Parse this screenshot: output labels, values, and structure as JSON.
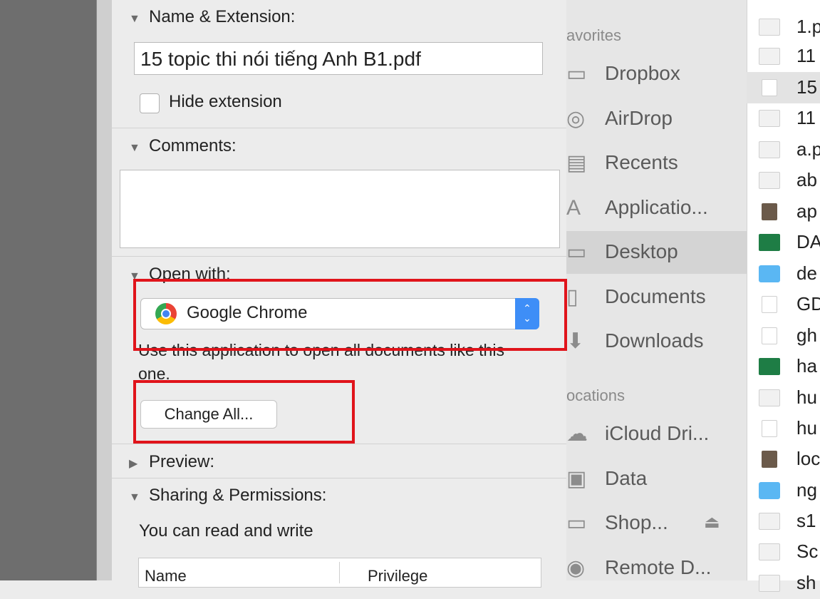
{
  "info_panel": {
    "name_ext_title": "Name & Extension:",
    "file_name": "15 topic thi nói tiếng Anh B1.pdf",
    "hide_extension_label": "Hide extension",
    "comments_title": "Comments:",
    "open_with_title": "Open with:",
    "app_name": "Google Chrome",
    "use_app_text": "Use this application to open all documents like this one.",
    "change_all_label": "Change All...",
    "preview_title": "Preview:",
    "sharing_title": "Sharing & Permissions:",
    "permission_text": "You can read and write",
    "table_headers": {
      "name": "Name",
      "privilege": "Privilege"
    }
  },
  "finder_sidebar": {
    "favorites_heading": "avorites",
    "locations_heading": "ocations",
    "favorites": [
      {
        "label": "Dropbox",
        "icon": "folder-icon"
      },
      {
        "label": "AirDrop",
        "icon": "airdrop-icon"
      },
      {
        "label": "Recents",
        "icon": "recents-icon"
      },
      {
        "label": "Applicatio...",
        "icon": "applications-icon"
      },
      {
        "label": "Desktop",
        "icon": "desktop-icon",
        "selected": true
      },
      {
        "label": "Documents",
        "icon": "documents-icon"
      },
      {
        "label": "Downloads",
        "icon": "downloads-icon"
      }
    ],
    "locations": [
      {
        "label": "iCloud Dri...",
        "icon": "cloud-icon"
      },
      {
        "label": "Data",
        "icon": "disk-icon"
      },
      {
        "label": "Shop...",
        "icon": "drive-icon",
        "eject": "⏏"
      },
      {
        "label": "Remote D...",
        "icon": "remote-disc-icon"
      }
    ]
  },
  "file_list": [
    {
      "name": "1.p",
      "kind": "blank"
    },
    {
      "name": "11",
      "kind": "blank"
    },
    {
      "name": "15",
      "kind": "doc",
      "selected": true
    },
    {
      "name": "11",
      "kind": "blank"
    },
    {
      "name": "a.p",
      "kind": "blank"
    },
    {
      "name": "ab",
      "kind": "blank"
    },
    {
      "name": "ap",
      "kind": "img"
    },
    {
      "name": "DA",
      "kind": "xl"
    },
    {
      "name": "de",
      "kind": "folder"
    },
    {
      "name": "GD",
      "kind": "doc"
    },
    {
      "name": "gh",
      "kind": "doc"
    },
    {
      "name": "ha",
      "kind": "xl"
    },
    {
      "name": "hu",
      "kind": "blank"
    },
    {
      "name": "hu",
      "kind": "doc"
    },
    {
      "name": "loc",
      "kind": "img"
    },
    {
      "name": "ng",
      "kind": "folder"
    },
    {
      "name": "s1",
      "kind": "blank"
    },
    {
      "name": "Sc",
      "kind": "blank"
    },
    {
      "name": "sh",
      "kind": "blank"
    }
  ],
  "colors": {
    "highlight": "#e0141b",
    "accent": "#3e8ef7",
    "selection": "#d4d4d4"
  }
}
